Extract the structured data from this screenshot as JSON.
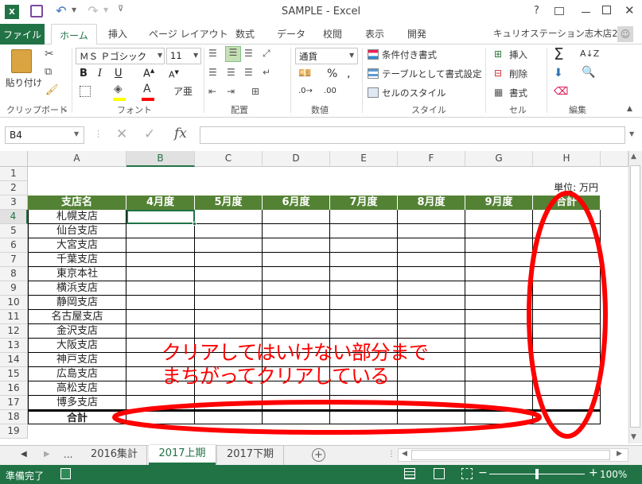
{
  "window": {
    "title": "SAMPLE - Excel",
    "help": "?",
    "user": "キュリオステーション志木店2"
  },
  "tabs": [
    "ファイル",
    "ホーム",
    "挿入",
    "ページ レイアウト",
    "数式",
    "データ",
    "校閲",
    "表示",
    "開発"
  ],
  "ribbon": {
    "paste": "貼り付け",
    "font_name": "ＭＳ Ｐゴシック",
    "font_size": "11",
    "number_format": "通貨",
    "conditional": "条件付き書式",
    "as_table": "テーブルとして書式設定",
    "cell_style": "セルのスタイル",
    "insert": "挿入",
    "delete": "削除",
    "format": "書式",
    "groups": {
      "clipboard": "クリップボード",
      "font": "フォント",
      "align": "配置",
      "number": "数値",
      "style": "スタイル",
      "cells": "セル",
      "edit": "編集"
    }
  },
  "formula_bar": {
    "name_box": "B4",
    "fx": "fx",
    "value": ""
  },
  "sheet": {
    "columns": [
      "A",
      "B",
      "C",
      "D",
      "E",
      "F",
      "G",
      "H"
    ],
    "rows": [
      "1",
      "2",
      "3",
      "4",
      "5",
      "6",
      "7",
      "8",
      "9",
      "10",
      "11",
      "12",
      "13",
      "14",
      "15",
      "16",
      "17",
      "18",
      "19"
    ],
    "unit": "単位: 万円",
    "header": [
      "支店名",
      "4月度",
      "5月度",
      "6月度",
      "7月度",
      "8月度",
      "9月度",
      "合計"
    ],
    "branches": [
      "札幌支店",
      "仙台支店",
      "大宮支店",
      "千葉支店",
      "東京本社",
      "横浜支店",
      "静岡支店",
      "名古屋支店",
      "金沢支店",
      "大阪支店",
      "神戸支店",
      "広島支店",
      "高松支店",
      "博多支店"
    ],
    "total_label": "合計",
    "header_color": "#548235",
    "annotation_line1": "クリアしてはいけない部分まで",
    "annotation_line2": "まちがってクリアしている",
    "annotation_color": "#ff0000"
  },
  "sheet_tabs": {
    "ellipsis": "...",
    "tabs": [
      "2016集計",
      "2017上期",
      "2017下期"
    ],
    "active": "2017上期"
  },
  "status": {
    "ready": "準備完了",
    "zoom": "100%"
  }
}
